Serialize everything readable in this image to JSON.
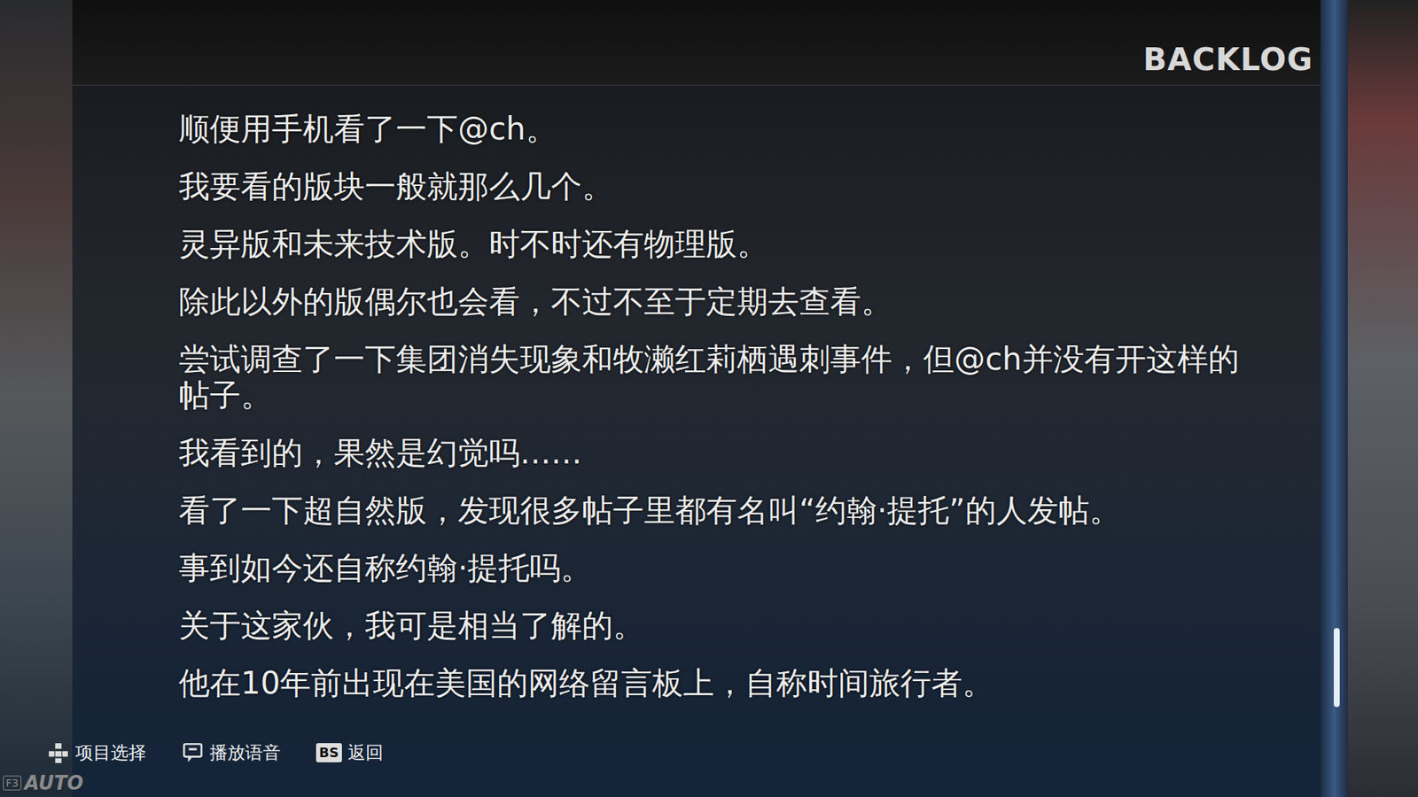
{
  "screen": {
    "title": "BACKLOG"
  },
  "backlog": {
    "lines": [
      "顺便用手机看了一下@ch。",
      "我要看的版块一般就那么几个。",
      "灵异版和未来技术版。时不时还有物理版。",
      "除此以外的版偶尔也会看，不过不至于定期去查看。",
      "尝试调查了一下集团消失现象和牧濑红莉栖遇刺事件，但@ch并没有开这样的帖子。",
      "我看到的，果然是幻觉吗……",
      "看了一下超自然版，发现很多帖子里都有名叫“约翰·提托”的人发帖。",
      "事到如今还自称约翰·提托吗。",
      "关于这家伙，我可是相当了解的。",
      "他在10年前出现在美国的网络留言板上，自称时间旅行者。"
    ]
  },
  "scrollbar": {
    "thumb_start": 0.79,
    "thumb_size": 0.1
  },
  "controls": [
    {
      "kind": "dpad",
      "label": "项目选择"
    },
    {
      "kind": "voice",
      "label": "播放语音"
    },
    {
      "kind": "key",
      "key": "BS",
      "label": "返回"
    }
  ],
  "mode": {
    "key": "F3",
    "label": "AUTO"
  }
}
